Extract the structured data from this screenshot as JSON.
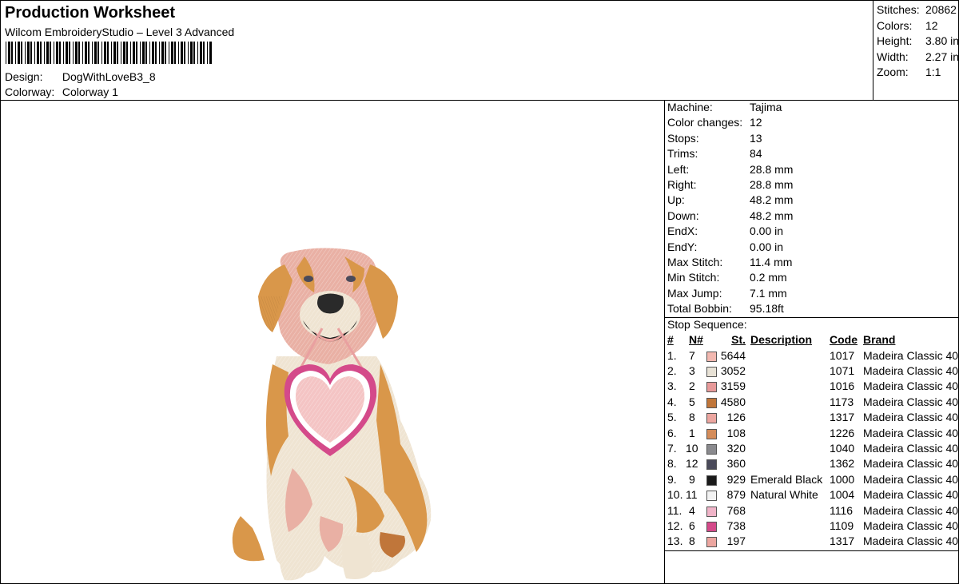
{
  "header": {
    "title": "Production Worksheet",
    "subtitle": "Wilcom EmbroideryStudio – Level 3 Advanced",
    "design_label": "Design:",
    "design_value": "DogWithLoveB3_8",
    "colorway_label": "Colorway:",
    "colorway_value": "Colorway 1"
  },
  "stats": [
    {
      "label": "Stitches:",
      "value": "20862"
    },
    {
      "label": "Colors:",
      "value": "12"
    },
    {
      "label": "Height:",
      "value": "3.80 in"
    },
    {
      "label": "Width:",
      "value": "2.27 in"
    },
    {
      "label": "Zoom:",
      "value": "1:1"
    }
  ],
  "machine": [
    {
      "label": "Machine:",
      "value": "Tajima"
    },
    {
      "label": "Color changes:",
      "value": "12"
    },
    {
      "label": "Stops:",
      "value": "13"
    },
    {
      "label": "Trims:",
      "value": "84"
    },
    {
      "label": "Left:",
      "value": "28.8 mm"
    },
    {
      "label": "Right:",
      "value": "28.8 mm"
    },
    {
      "label": "Up:",
      "value": "48.2 mm"
    },
    {
      "label": "Down:",
      "value": "48.2 mm"
    },
    {
      "label": "EndX:",
      "value": "0.00 in"
    },
    {
      "label": "EndY:",
      "value": "0.00 in"
    },
    {
      "label": "Max Stitch:",
      "value": "11.4 mm"
    },
    {
      "label": "Min Stitch:",
      "value": "0.2 mm"
    },
    {
      "label": "Max Jump:",
      "value": "7.1 mm"
    },
    {
      "label": "Total Bobbin:",
      "value": "95.18ft"
    }
  ],
  "stop_sequence": {
    "title": "Stop Sequence:",
    "headers": {
      "idx": "#",
      "n": "N#",
      "st": "St.",
      "desc": "Description",
      "code": "Code",
      "brand": "Brand"
    },
    "rows": [
      {
        "idx": "1.",
        "n": "7",
        "color": "#f2b8b0",
        "st": "5644",
        "desc": "",
        "code": "1017",
        "brand": "Madeira Classic 40"
      },
      {
        "idx": "2.",
        "n": "3",
        "color": "#e8e2d6",
        "st": "3052",
        "desc": "",
        "code": "1071",
        "brand": "Madeira Classic 40"
      },
      {
        "idx": "3.",
        "n": "2",
        "color": "#e89a9a",
        "st": "3159",
        "desc": "",
        "code": "1016",
        "brand": "Madeira Classic 40"
      },
      {
        "idx": "4.",
        "n": "5",
        "color": "#c0763a",
        "st": "4580",
        "desc": "",
        "code": "1173",
        "brand": "Madeira Classic 40"
      },
      {
        "idx": "5.",
        "n": "8",
        "color": "#eca6a0",
        "st": "126",
        "desc": "",
        "code": "1317",
        "brand": "Madeira Classic 40"
      },
      {
        "idx": "6.",
        "n": "1",
        "color": "#d48c5a",
        "st": "108",
        "desc": "",
        "code": "1226",
        "brand": "Madeira Classic 40"
      },
      {
        "idx": "7.",
        "n": "10",
        "color": "#8a8a8e",
        "st": "320",
        "desc": "",
        "code": "1040",
        "brand": "Madeira Classic 40"
      },
      {
        "idx": "8.",
        "n": "12",
        "color": "#4a4a5a",
        "st": "360",
        "desc": "",
        "code": "1362",
        "brand": "Madeira Classic 40"
      },
      {
        "idx": "9.",
        "n": "9",
        "color": "#1a1a1a",
        "st": "929",
        "desc": "Emerald Black",
        "code": "1000",
        "brand": "Madeira Classic 40"
      },
      {
        "idx": "10.",
        "n": "11",
        "color": "#f2f2f2",
        "st": "879",
        "desc": "Natural White",
        "code": "1004",
        "brand": "Madeira Classic 40"
      },
      {
        "idx": "11.",
        "n": "4",
        "color": "#f0b4c8",
        "st": "768",
        "desc": "",
        "code": "1116",
        "brand": "Madeira Classic 40"
      },
      {
        "idx": "12.",
        "n": "6",
        "color": "#d44a8a",
        "st": "738",
        "desc": "",
        "code": "1109",
        "brand": "Madeira Classic 40"
      },
      {
        "idx": "13.",
        "n": "8",
        "color": "#eca6a0",
        "st": "197",
        "desc": "",
        "code": "1317",
        "brand": "Madeira Classic 40"
      }
    ]
  },
  "colors": {
    "coat_gold": "#d9974a",
    "coat_cream": "#efe4d2",
    "coat_pink": "#e9b0a4",
    "heart_fill": "#f4c4c4",
    "heart_border": "#d44a8a"
  }
}
